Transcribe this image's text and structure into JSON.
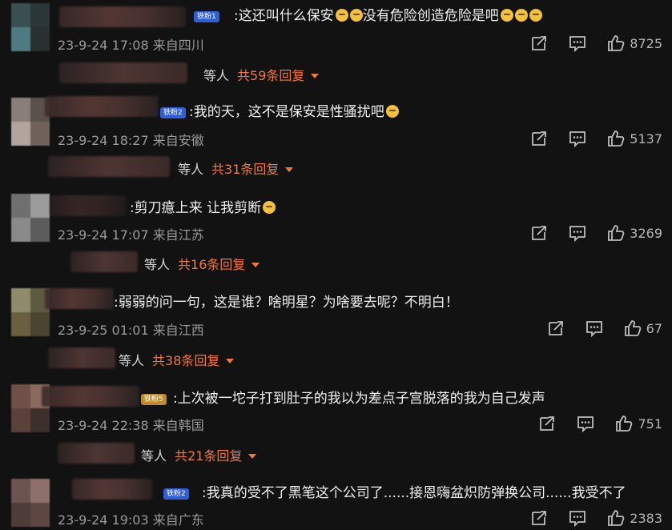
{
  "comments": [
    {
      "badge": "铁粉1",
      "text": ":这还叫什么保安",
      "text2": "没有危险创造危险是吧",
      "time": "23-9-24 17:08",
      "location": "来自四川",
      "likes": "8725",
      "reply_who": "等人",
      "reply_count": "共59条回复"
    },
    {
      "badge": "铁粉2",
      "text": ":我的天，这不是保安是性骚扰吧",
      "time": "23-9-24 18:27",
      "location": "来自安徽",
      "likes": "5137",
      "reply_who": "等人",
      "reply_count": "共31条回复"
    },
    {
      "text": ":剪刀癔上来 让我剪断",
      "time": "23-9-24 17:07",
      "location": "来自江苏",
      "likes": "3269",
      "reply_who": "等人",
      "reply_count": "共16条回复"
    },
    {
      "text": ":弱弱的问一句，这是谁？啥明星？为啥要去呢？不明白！",
      "time": "23-9-25 01:01",
      "location": "来自江西",
      "likes": "67",
      "reply_who": "等人",
      "reply_count": "共38条回复"
    },
    {
      "badge": "铁粉5",
      "text": ":上次被一坨子打到肚子的我以为差点子宫脱落的我为自己发声",
      "time": "23-9-24 22:38",
      "location": "来自韩国",
      "likes": "751",
      "reply_who": "等人",
      "reply_count": "共21条回复"
    },
    {
      "badge": "铁粉2",
      "text": ":我真的受不了黑笔这个公司了......接恩嗨盆炽防弹换公司......我受不了",
      "time": "23-9-24 19:03",
      "location": "来自广东",
      "likes": "2383"
    }
  ],
  "icons": {
    "share": "share-icon",
    "comment": "comment-icon",
    "like": "like-icon",
    "expand": "caret-down-icon"
  },
  "colors": {
    "background": "#121212",
    "reply_accent": "#f07a39",
    "badge_blue": "#2f5fd8"
  }
}
